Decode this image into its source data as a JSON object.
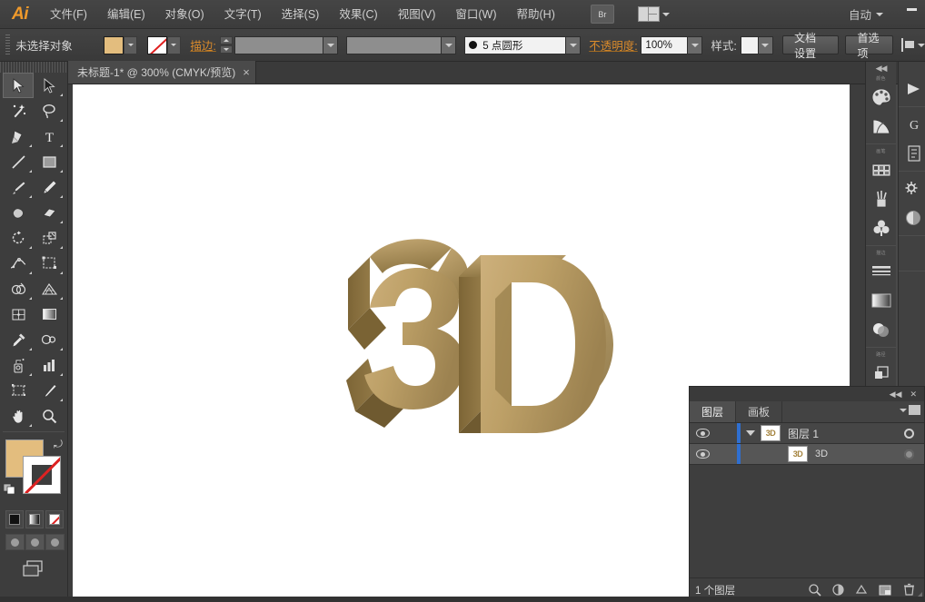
{
  "app": {
    "name": "Adobe Illustrator",
    "logo_text": "Ai",
    "accent_color": "#f09a2b",
    "chrome_color": "#3d3d3d"
  },
  "menubar": {
    "items": [
      {
        "label": "文件(F)",
        "name": "menu-file"
      },
      {
        "label": "编辑(E)",
        "name": "menu-edit"
      },
      {
        "label": "对象(O)",
        "name": "menu-object"
      },
      {
        "label": "文字(T)",
        "name": "menu-type"
      },
      {
        "label": "选择(S)",
        "name": "menu-select"
      },
      {
        "label": "效果(C)",
        "name": "menu-effect"
      },
      {
        "label": "视图(V)",
        "name": "menu-view"
      },
      {
        "label": "窗口(W)",
        "name": "menu-window"
      },
      {
        "label": "帮助(H)",
        "name": "menu-help"
      }
    ],
    "bridge_button_label": "Br",
    "arrange_documents_label": "",
    "workspace_label": "自动",
    "minimize_label": "—"
  },
  "controlbar": {
    "selection_status": "未选择对象",
    "fill_color": "#e3bd7e",
    "stroke_label": "描边:",
    "stroke_weight_value": "",
    "stroke_profile_value": "",
    "brush_definition_value": "5 点圆形",
    "opacity_label": "不透明度:",
    "opacity_value": "100%",
    "style_label": "样式:",
    "document_setup_label": "文档设置",
    "preferences_label": "首选项"
  },
  "tabbar": {
    "document_tab": "未标题-1* @ 300% (CMYK/预览)",
    "close_glyph": "×"
  },
  "toolbar": {
    "tools": [
      {
        "name": "selection-tool",
        "selected": true
      },
      {
        "name": "direct-selection-tool",
        "selected": false
      },
      {
        "name": "magic-wand-tool",
        "selected": false
      },
      {
        "name": "lasso-tool",
        "selected": false
      },
      {
        "name": "pen-tool",
        "selected": false
      },
      {
        "name": "type-tool",
        "selected": false
      },
      {
        "name": "line-segment-tool",
        "selected": false
      },
      {
        "name": "rectangle-tool",
        "selected": false
      },
      {
        "name": "paintbrush-tool",
        "selected": false
      },
      {
        "name": "pencil-tool",
        "selected": false
      },
      {
        "name": "blob-brush-tool",
        "selected": false
      },
      {
        "name": "eraser-tool",
        "selected": false
      },
      {
        "name": "rotate-tool",
        "selected": false
      },
      {
        "name": "scale-tool",
        "selected": false
      },
      {
        "name": "width-tool",
        "selected": false
      },
      {
        "name": "free-transform-tool",
        "selected": false
      },
      {
        "name": "shape-builder-tool",
        "selected": false
      },
      {
        "name": "perspective-grid-tool",
        "selected": false
      },
      {
        "name": "mesh-tool",
        "selected": false
      },
      {
        "name": "gradient-tool",
        "selected": false
      },
      {
        "name": "eyedropper-tool",
        "selected": false
      },
      {
        "name": "blend-tool",
        "selected": false
      },
      {
        "name": "symbol-sprayer-tool",
        "selected": false
      },
      {
        "name": "column-graph-tool",
        "selected": false
      },
      {
        "name": "artboard-tool",
        "selected": false
      },
      {
        "name": "slice-tool",
        "selected": false
      },
      {
        "name": "hand-tool",
        "selected": false
      },
      {
        "name": "zoom-tool",
        "selected": false
      }
    ],
    "fill_swatch_color": "#e3bd7e",
    "stroke_swatch": "none",
    "color_mode_buttons": [
      "color-mode-solid",
      "color-mode-gradient",
      "color-mode-none"
    ],
    "screen_mode_buttons": [
      "draw-normal",
      "draw-behind",
      "draw-inside"
    ],
    "screen_mode_label": "change-screen-mode"
  },
  "canvas": {
    "artwork_label": "3D",
    "artwork_face_color": "#b99d62",
    "artwork_side_color": "#836b3c",
    "artwork_highlight_color": "#cdb07c",
    "artwork_shadow_color": "#6f5a30",
    "artboard_background": "#ffffff",
    "zoom_level": "300%"
  },
  "right_rails": {
    "rail_a_groups": [
      {
        "caption": "颜色",
        "icons": [
          "color-palette-icon",
          "color-guide-icon"
        ]
      },
      {
        "caption": "画笔",
        "icons": [
          "swatches-icon",
          "brushes-icon",
          "symbols-icon"
        ]
      },
      {
        "caption": "描边",
        "icons": [
          "stroke-icon",
          "gradient-icon",
          "transparency-icon"
        ]
      },
      {
        "caption": "路径",
        "icons": [
          "pathfinder-icon"
        ]
      }
    ],
    "rail_b_icons": [
      "align-icon",
      "transform-icon",
      "appearance-icon",
      "graphic-styles-icon",
      "document-info-icon",
      "navigator-icon"
    ],
    "collapse_glyph": "◀◀"
  },
  "layers_panel": {
    "collapse_glyph": "◀◀",
    "close_glyph": "✕",
    "tabs": [
      {
        "label": "图层",
        "name": "tab-layers",
        "active": true
      },
      {
        "label": "画板",
        "name": "tab-artboards",
        "active": false
      }
    ],
    "rows": [
      {
        "name": "图层 1",
        "thumb": "3D",
        "type": "layer",
        "visible": true,
        "expanded": true,
        "color": "#2f6fd0"
      },
      {
        "name": "3D",
        "thumb": "3D",
        "type": "object",
        "visible": true,
        "expanded": false,
        "color": "#2f6fd0"
      }
    ],
    "footer_status": "1 个图层",
    "footer_buttons": [
      {
        "name": "locate-object-button"
      },
      {
        "name": "make-clipping-mask-button"
      },
      {
        "name": "create-new-sublayer-button"
      },
      {
        "name": "create-new-layer-button"
      },
      {
        "name": "delete-selection-button"
      }
    ]
  }
}
